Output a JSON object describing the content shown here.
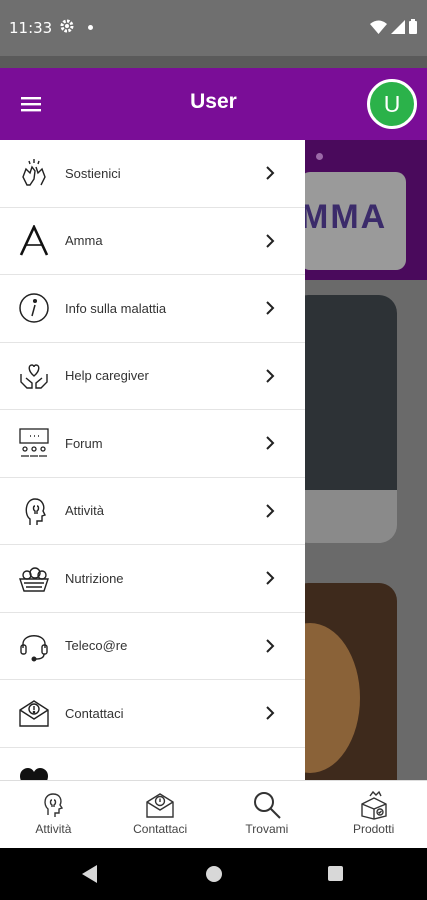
{
  "status_bar": {
    "time": "11:33"
  },
  "app_bar": {
    "title": "User",
    "avatar_letter": "U"
  },
  "background": {
    "logo_text": "MMA"
  },
  "drawer": {
    "items": [
      {
        "label": "Sostienici",
        "icon": "clapping-hands-icon"
      },
      {
        "label": "Amma",
        "icon": "amma-logo-icon"
      },
      {
        "label": "Info sulla malattia",
        "icon": "info-icon"
      },
      {
        "label": "Help caregiver",
        "icon": "heart-hands-icon"
      },
      {
        "label": "Forum",
        "icon": "forum-icon"
      },
      {
        "label": "Attività",
        "icon": "head-lightbulb-icon"
      },
      {
        "label": "Nutrizione",
        "icon": "fruit-basket-icon"
      },
      {
        "label": "Teleco@re",
        "icon": "headset-icon"
      },
      {
        "label": "Contattaci",
        "icon": "envelope-icon"
      },
      {
        "label": "",
        "icon": "heart-icon"
      }
    ]
  },
  "bottom_nav": {
    "items": [
      {
        "label": "Attività",
        "icon": "lightbulb-icon"
      },
      {
        "label": "Contattaci",
        "icon": "envelope-icon"
      },
      {
        "label": "Trovami",
        "icon": "search-icon"
      },
      {
        "label": "Prodotti",
        "icon": "box-icon"
      }
    ]
  },
  "colors": {
    "app_bar": "#7a0d97",
    "avatar": "#2bb24a"
  }
}
